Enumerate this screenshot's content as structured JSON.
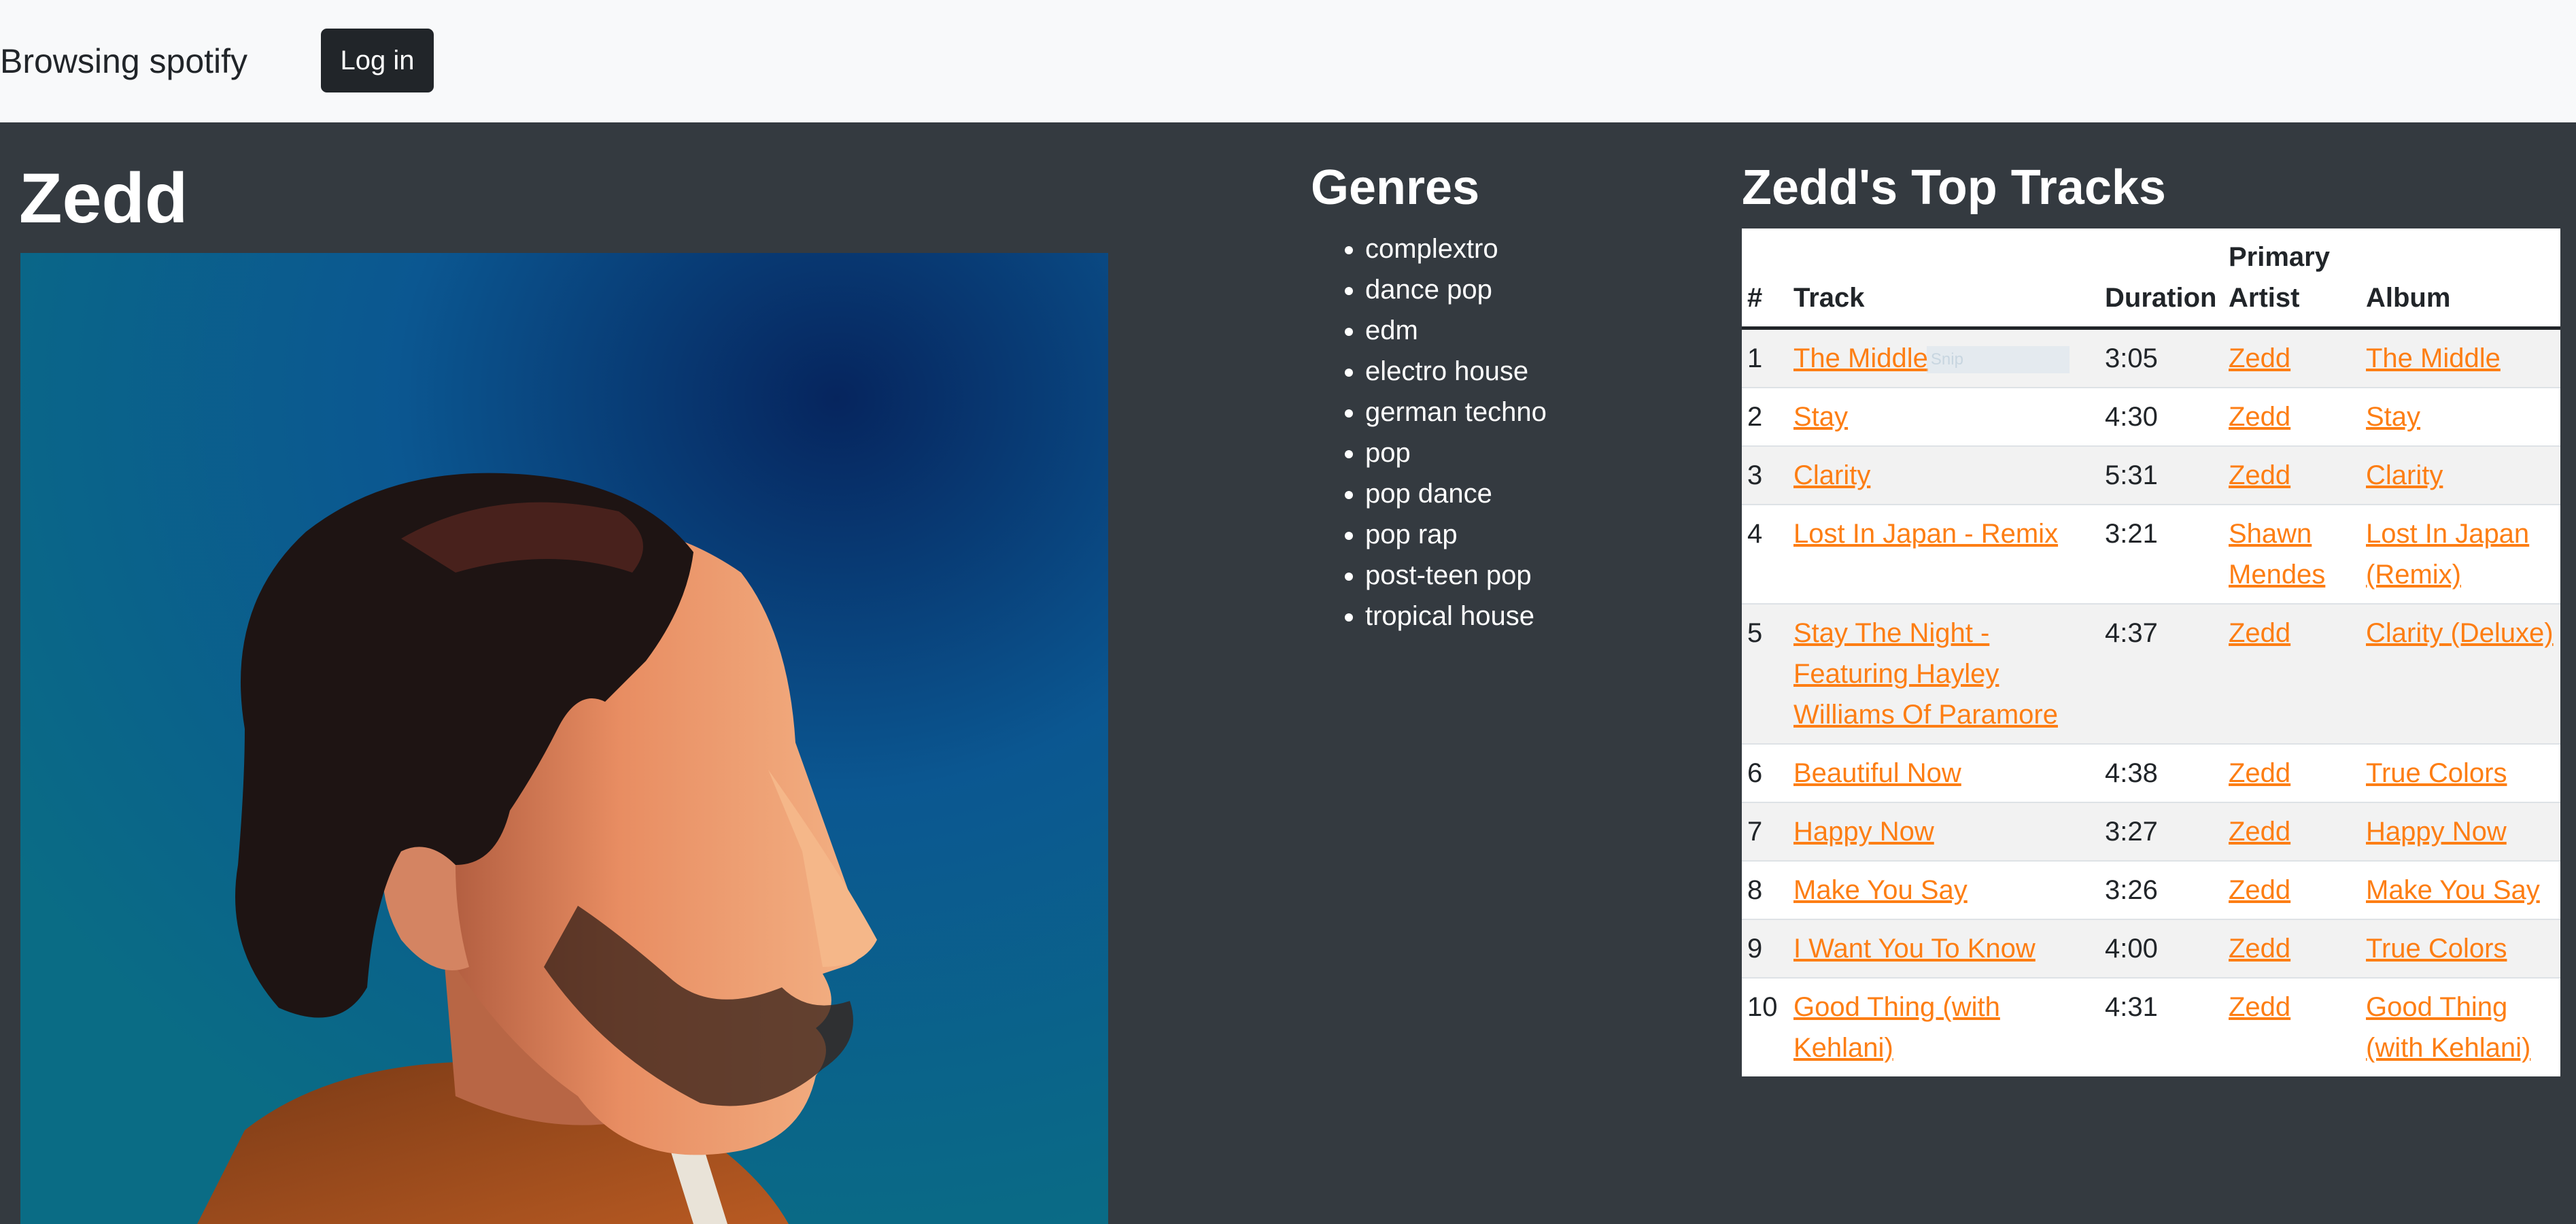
{
  "navbar": {
    "brand": "Browsing spotify",
    "login_label": "Log in"
  },
  "artist": {
    "name": "Zedd",
    "photo_icon": "artist-photo"
  },
  "genres": {
    "title": "Genres",
    "items": [
      "complextro",
      "dance pop",
      "edm",
      "electro house",
      "german techno",
      "pop",
      "pop dance",
      "pop rap",
      "post-teen pop",
      "tropical house"
    ]
  },
  "top_tracks": {
    "title": "Zedd's Top Tracks",
    "headers": {
      "num": "#",
      "track": "Track",
      "duration": "Duration",
      "artist": "Primary Artist",
      "album": "Album"
    },
    "snip_ghost": "Snip",
    "rows": [
      {
        "num": "1",
        "track": "The Middle",
        "duration": "3:05",
        "artist": "Zedd",
        "album": "The Middle"
      },
      {
        "num": "2",
        "track": "Stay",
        "duration": "4:30",
        "artist": "Zedd",
        "album": "Stay"
      },
      {
        "num": "3",
        "track": "Clarity",
        "duration": "5:31",
        "artist": "Zedd",
        "album": "Clarity"
      },
      {
        "num": "4",
        "track": "Lost In Japan - Remix",
        "duration": "3:21",
        "artist": "Shawn Mendes",
        "album": "Lost In Japan (Remix)"
      },
      {
        "num": "5",
        "track": "Stay The Night - Featuring Hayley Williams Of Paramore",
        "duration": "4:37",
        "artist": "Zedd",
        "album": "Clarity (Deluxe)"
      },
      {
        "num": "6",
        "track": "Beautiful Now",
        "duration": "4:38",
        "artist": "Zedd",
        "album": "True Colors"
      },
      {
        "num": "7",
        "track": "Happy Now",
        "duration": "3:27",
        "artist": "Zedd",
        "album": "Happy Now"
      },
      {
        "num": "8",
        "track": "Make You Say",
        "duration": "3:26",
        "artist": "Zedd",
        "album": "Make You Say"
      },
      {
        "num": "9",
        "track": "I Want You To Know",
        "duration": "4:00",
        "artist": "Zedd",
        "album": "True Colors"
      },
      {
        "num": "10",
        "track": "Good Thing (with Kehlani)",
        "duration": "4:31",
        "artist": "Zedd",
        "album": "Good Thing (with Kehlani)"
      }
    ]
  },
  "colors": {
    "navbar_bg": "#f8f9fa",
    "page_bg": "#343a40",
    "link": "#fd7e14",
    "button_bg": "#212529"
  }
}
